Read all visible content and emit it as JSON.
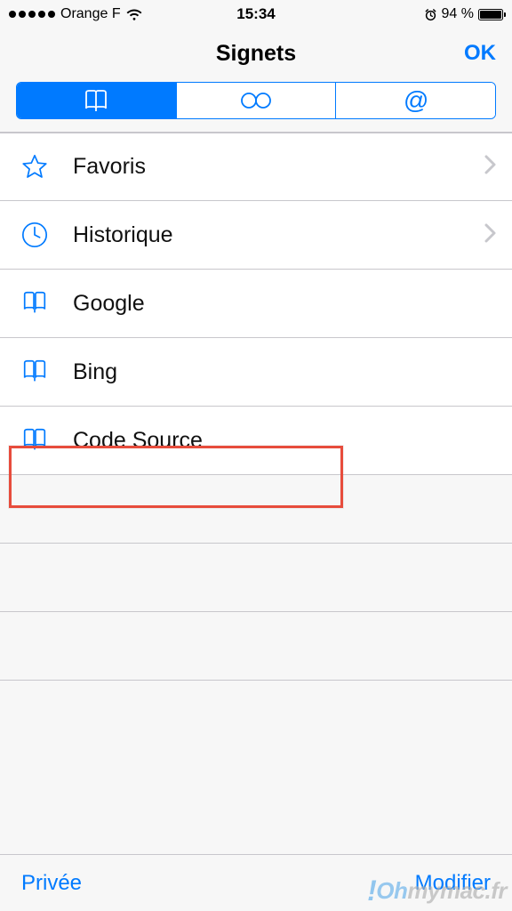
{
  "status": {
    "carrier": "Orange F",
    "time": "15:34",
    "battery_pct": "94 %"
  },
  "nav": {
    "title": "Signets",
    "done": "OK"
  },
  "segmented": {
    "active_index": 0
  },
  "rows": {
    "favorites": "Favoris",
    "history": "Historique",
    "google": "Google",
    "bing": "Bing",
    "codesource": "Code Source"
  },
  "toolbar": {
    "private": "Privée",
    "edit": "Modifier"
  },
  "watermark": {
    "text_oh": "Oh",
    "text_rest": "mymac.fr"
  },
  "colors": {
    "accent": "#007aff",
    "highlight": "#e74c3c"
  }
}
